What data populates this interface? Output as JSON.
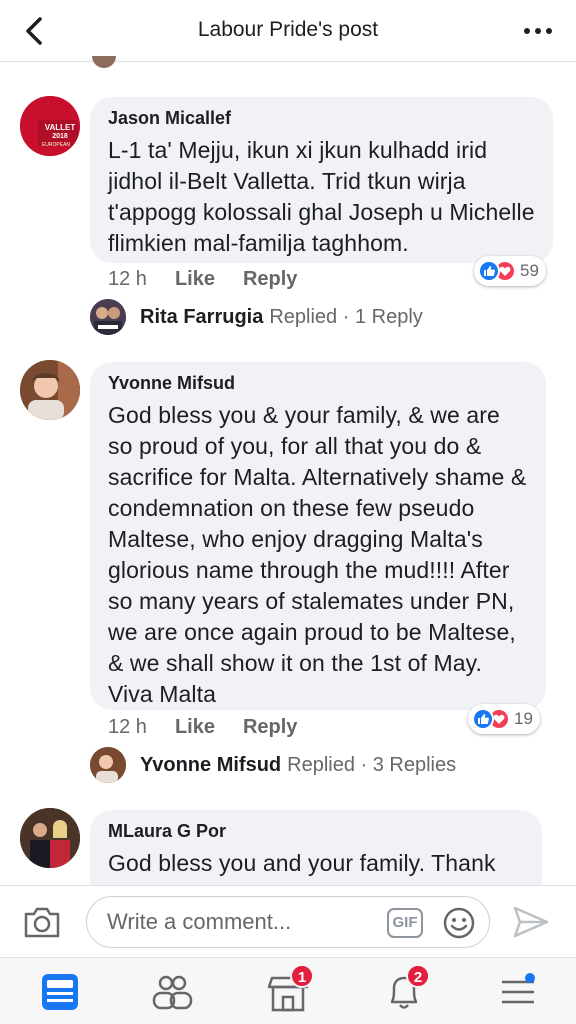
{
  "header": {
    "title": "Labour Pride's post"
  },
  "comments": [
    {
      "author": "Jason Micallef",
      "text": "L-1 ta' Mejju, ikun xi jkun kulhadd irid jidhol il-Belt Valletta. Trid tkun wirja t'appogg kolossali ghal Joseph u Michelle flimkien mal-familja taghhom.",
      "time": "12 h",
      "like_label": "Like",
      "reply_label": "Reply",
      "reactions": "59",
      "avatar_text": "VALLETTA 2018 EUROPEAN",
      "replied": {
        "name": "Rita Farrugia",
        "label": "Replied · 1 Reply"
      }
    },
    {
      "author": "Yvonne Mifsud",
      "text": "God bless you & your family, & we are so proud of you, for all that you do & sacrifice for Malta.  Alternatively shame & condemnation on these few pseudo Maltese, who enjoy dragging Malta's glorious name through the mud!!!! After so many years of stalemates under PN, we are once again proud to be Maltese, & we shall show it on the 1st of May. Viva Malta",
      "time": "12 h",
      "like_label": "Like",
      "reply_label": "Reply",
      "reactions": "19",
      "replied": {
        "name": "Yvonne Mifsud",
        "label": "Replied · 3 Replies"
      }
    },
    {
      "author": "MLaura G Por",
      "text": "God bless you and your family. Thank"
    }
  ],
  "composer": {
    "placeholder": "Write a comment...",
    "gif_label": "GIF"
  },
  "tabbar": {
    "items": [
      {
        "icon": "news-feed-icon",
        "badge": ""
      },
      {
        "icon": "friends-icon",
        "badge": ""
      },
      {
        "icon": "marketplace-icon",
        "badge": "1"
      },
      {
        "icon": "notifications-bell-icon",
        "badge": "2"
      },
      {
        "icon": "menu-icon",
        "badge": ""
      }
    ]
  },
  "colors": {
    "accent": "#1877f2",
    "love": "#f33e58",
    "badge": "#e41e3f",
    "bubble": "#f0f2f5"
  }
}
